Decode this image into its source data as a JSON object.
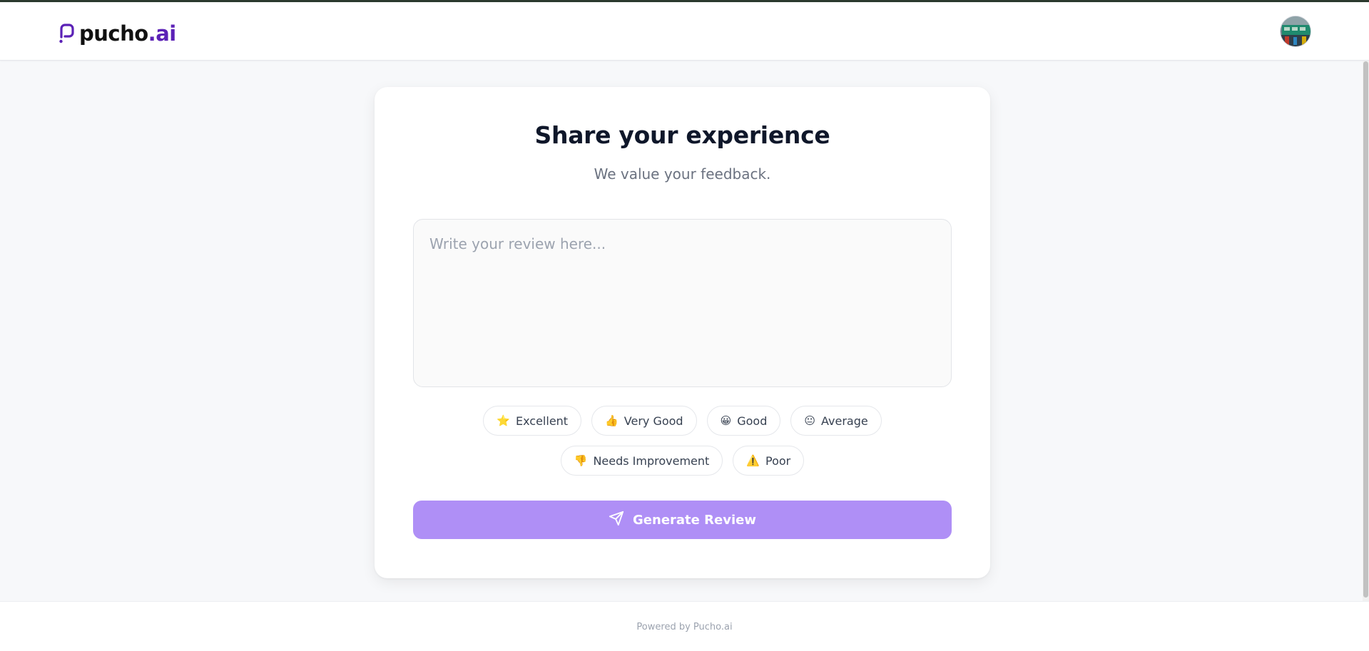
{
  "header": {
    "logo_text_main": "pucho",
    "logo_text_accent": ".ai",
    "avatar_alt": "user-avatar"
  },
  "main": {
    "title": "Share your experience",
    "subtitle": "We value your feedback.",
    "review_placeholder": "Write your review here...",
    "review_value": "",
    "chips_row1": [
      {
        "emoji": "⭐",
        "label": "Excellent"
      },
      {
        "emoji": "👍",
        "label": "Very Good"
      },
      {
        "emoji": "😀",
        "label": "Good"
      },
      {
        "emoji": "😐",
        "label": "Average"
      }
    ],
    "chips_row2": [
      {
        "emoji": "👎",
        "label": "Needs Improvement"
      },
      {
        "emoji": "⚠️",
        "label": "Poor"
      }
    ],
    "generate_label": "Generate Review"
  },
  "footer": {
    "powered_by": "Powered by Pucho.ai"
  },
  "colors": {
    "brand": "#5b21b6",
    "button": "#af8ff6",
    "background": "#f7f8fa"
  },
  "icons": [
    "logo-mark-icon",
    "send-icon",
    "star-icon",
    "thumbs-up-icon",
    "smile-icon",
    "neutral-face-icon",
    "thumbs-down-icon",
    "warning-icon"
  ]
}
